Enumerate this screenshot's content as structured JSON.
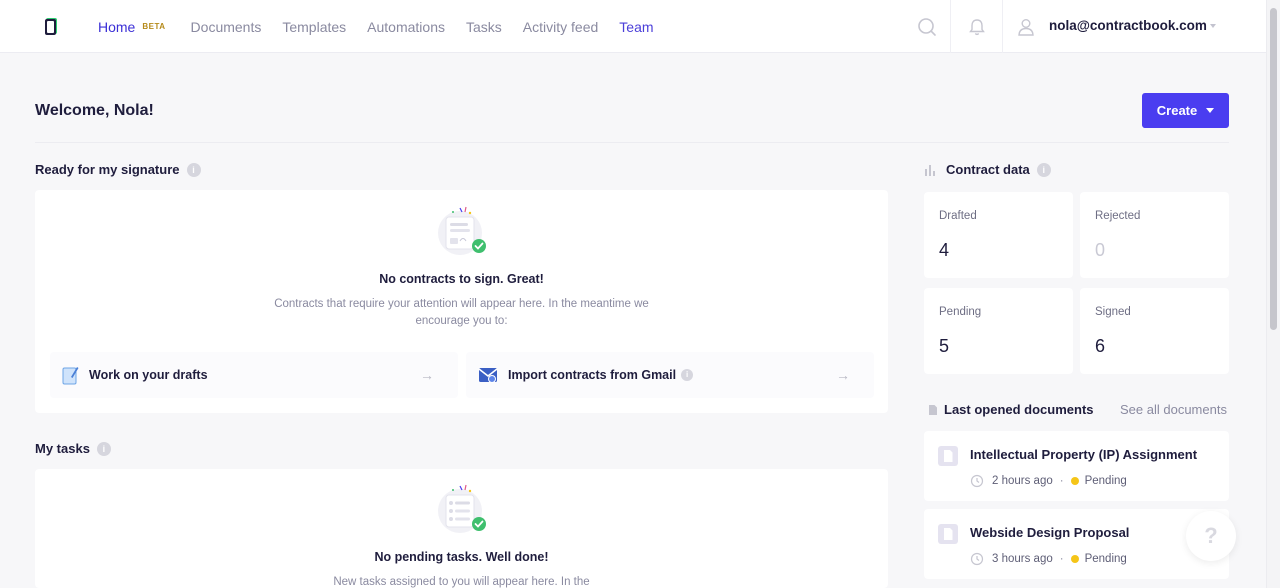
{
  "nav": {
    "items": [
      {
        "label": "Home",
        "badge": "BETA"
      },
      {
        "label": "Documents"
      },
      {
        "label": "Templates"
      },
      {
        "label": "Automations"
      },
      {
        "label": "Tasks"
      },
      {
        "label": "Activity feed"
      },
      {
        "label": "Team"
      }
    ],
    "user_email": "nola@contractbook.com"
  },
  "header": {
    "welcome": "Welcome, Nola!",
    "create_label": "Create"
  },
  "signature": {
    "title": "Ready for my signature",
    "info": "i",
    "empty_title": "No contracts to sign. Great!",
    "empty_text_1": "Contracts that require your attention will appear here. In the meantime we",
    "empty_text_2": "encourage you to:",
    "actions": [
      {
        "label": "Work on your drafts",
        "icon": "drafts-icon"
      },
      {
        "label": "Import contracts from Gmail",
        "icon": "gmail-icon"
      }
    ]
  },
  "tasks": {
    "title": "My tasks",
    "info": "i",
    "empty_title": "No pending tasks. Well done!",
    "empty_text": "New tasks assigned to you will appear here. In the"
  },
  "contract_data": {
    "title": "Contract data",
    "info": "i",
    "stats": [
      {
        "label": "Drafted",
        "value": "4"
      },
      {
        "label": "Rejected",
        "value": "0"
      },
      {
        "label": "Pending",
        "value": "5"
      },
      {
        "label": "Signed",
        "value": "6"
      }
    ]
  },
  "last_opened": {
    "title": "Last opened documents",
    "see_all": "See all documents",
    "docs": [
      {
        "title": "Intellectual Property (IP) Assignment",
        "time": "2 hours ago",
        "status": "Pending"
      },
      {
        "title": "Webside Design Proposal",
        "time": "3 hours ago",
        "status": "Pending"
      }
    ]
  },
  "help": {
    "label": "?"
  },
  "colors": {
    "accent": "#4a3df0",
    "pending": "#f5c518",
    "check": "#3fbf6e"
  }
}
